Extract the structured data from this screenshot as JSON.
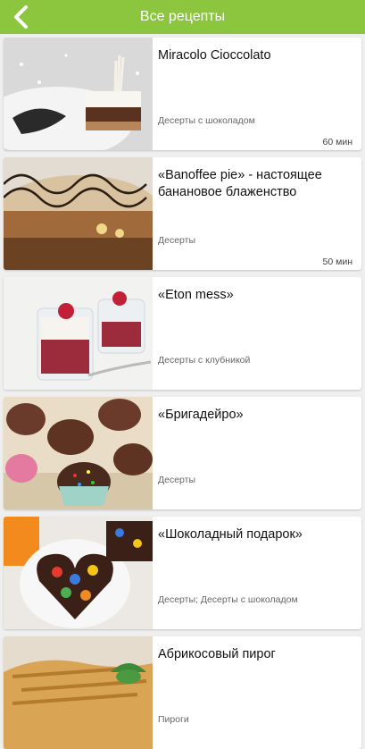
{
  "header": {
    "title": "Все рецепты",
    "accent_color": "#8cc63f",
    "back_icon": "chevron-left-icon"
  },
  "recipes": [
    {
      "title": "Miracolo Cioccolato",
      "category": "Десерты с шоколадом",
      "time": "60 мин"
    },
    {
      "title": "«Banoffee pie» - настоящее банановое блаженство",
      "category": "Десерты",
      "time": "50 мин"
    },
    {
      "title": "«Eton mess»",
      "category": "Десерты с клубникой",
      "time": ""
    },
    {
      "title": "«Бригадейро»",
      "category": "Десерты",
      "time": ""
    },
    {
      "title": "«Шоколадный подарок»",
      "category": "Десерты; Десерты с шоколадом",
      "time": ""
    },
    {
      "title": "Абрикосовый пирог",
      "category": "Пироги",
      "time": ""
    }
  ]
}
